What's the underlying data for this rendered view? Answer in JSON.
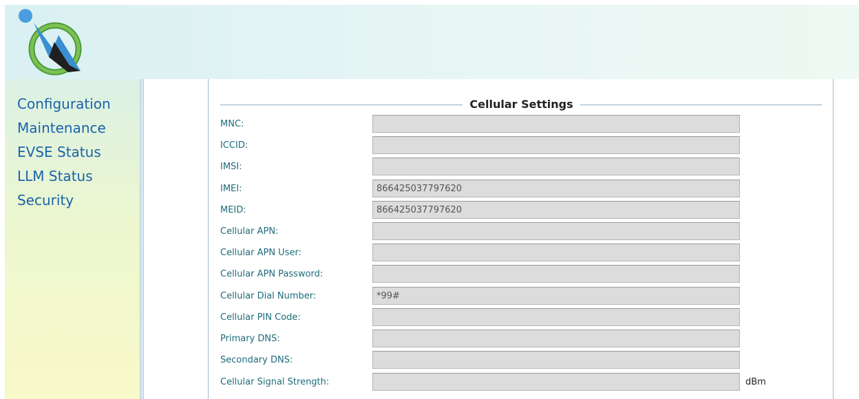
{
  "nav": {
    "items": [
      {
        "label": "Configuration"
      },
      {
        "label": "Maintenance"
      },
      {
        "label": "EVSE Status"
      },
      {
        "label": "LLM Status"
      },
      {
        "label": "Security"
      }
    ]
  },
  "section": {
    "title": "Cellular Settings",
    "fields": [
      {
        "label": "MNC:",
        "value": ""
      },
      {
        "label": "ICCID:",
        "value": ""
      },
      {
        "label": "IMSI:",
        "value": ""
      },
      {
        "label": "IMEI:",
        "value": "866425037797620"
      },
      {
        "label": "MEID:",
        "value": "866425037797620"
      },
      {
        "label": "Cellular APN:",
        "value": ""
      },
      {
        "label": "Cellular APN User:",
        "value": ""
      },
      {
        "label": "Cellular APN Password:",
        "value": ""
      },
      {
        "label": "Cellular Dial Number:",
        "value": "*99#"
      },
      {
        "label": "Cellular PIN Code:",
        "value": ""
      },
      {
        "label": "Primary DNS:",
        "value": ""
      },
      {
        "label": "Secondary DNS:",
        "value": ""
      },
      {
        "label": "Cellular Signal Strength:",
        "value": ""
      }
    ],
    "signal_unit": "dBm"
  },
  "colors": {
    "nav_link": "#1a63a8",
    "label": "#1e6b7a",
    "input_bg": "#dcdcdc"
  }
}
